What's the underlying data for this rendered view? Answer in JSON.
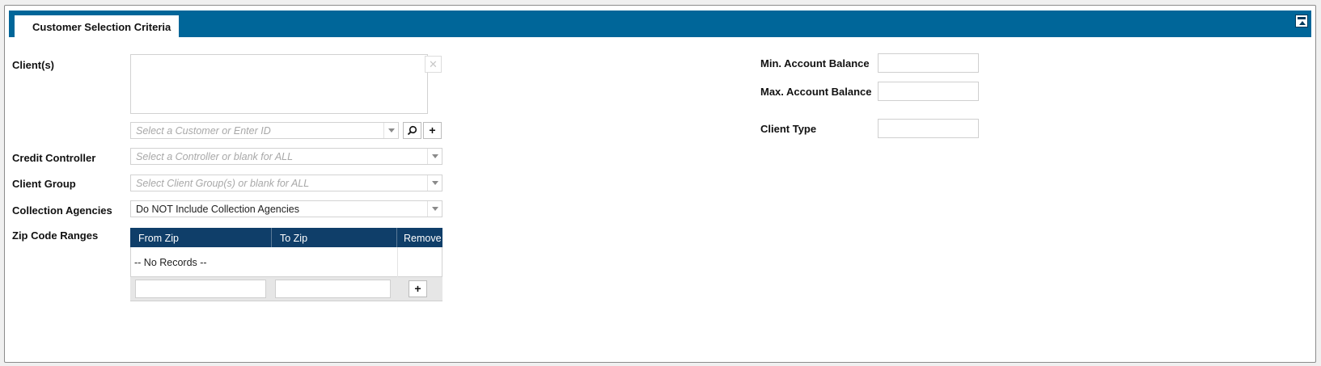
{
  "header": {
    "tab_label": "Customer Selection Criteria"
  },
  "icons": {
    "collapse": "collapse-panel-icon",
    "clear": "close-icon",
    "search": "search-icon",
    "add": "plus-icon"
  },
  "colors": {
    "header_bar": "#006699",
    "grid_header": "#0f3e69"
  },
  "left": {
    "clients_label": "Client(s)",
    "clear_symbol": "✕",
    "customer_placeholder": "Select a Customer or Enter ID",
    "add_symbol": "+",
    "credit_controller_label": "Credit Controller",
    "credit_controller_placeholder": "Select a Controller or blank for ALL",
    "client_group_label": "Client Group",
    "client_group_placeholder": "Select Client Group(s) or blank for ALL",
    "collection_agencies_label": "Collection Agencies",
    "collection_agencies_value": "Do NOT Include Collection Agencies",
    "zip_label": "Zip Code Ranges",
    "zip_grid": {
      "columns": [
        "From Zip",
        "To Zip",
        "Remove"
      ],
      "empty_text": "-- No Records --",
      "add_symbol": "+"
    }
  },
  "right": {
    "min_balance_label": "Min. Account Balance",
    "max_balance_label": "Max. Account Balance",
    "client_type_label": "Client Type"
  }
}
